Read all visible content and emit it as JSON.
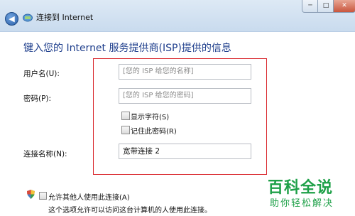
{
  "window": {
    "title": "连接到 Internet",
    "min_glyph": "─",
    "max_glyph": "□",
    "close_glyph": "✕"
  },
  "heading": "键入您的 Internet 服务提供商(ISP)提供的信息",
  "form": {
    "username": {
      "label": "用户名(U):",
      "placeholder": "[您的 ISP 给您的名称]",
      "value": ""
    },
    "password": {
      "label": "密码(P):",
      "placeholder": "[您的 ISP 给您的密码]",
      "value": ""
    },
    "show_chars": {
      "label": "显示字符(S)",
      "checked": false
    },
    "remember_password": {
      "label": "记住此密码(R)",
      "checked": false
    },
    "connection_name": {
      "label": "连接名称(N):",
      "value": "宽带连接 2"
    }
  },
  "allow_others": {
    "label": "允许其他人使用此连接(A)",
    "description": "这个选项允许可以访问这台计算机的人使用此连接。",
    "checked": false
  },
  "watermark": {
    "main": "百科全说",
    "sub": "助你轻松解决"
  },
  "colors": {
    "heading": "#1e3e8c",
    "highlight_frame": "#d9262c",
    "watermark": "#1ea048"
  }
}
